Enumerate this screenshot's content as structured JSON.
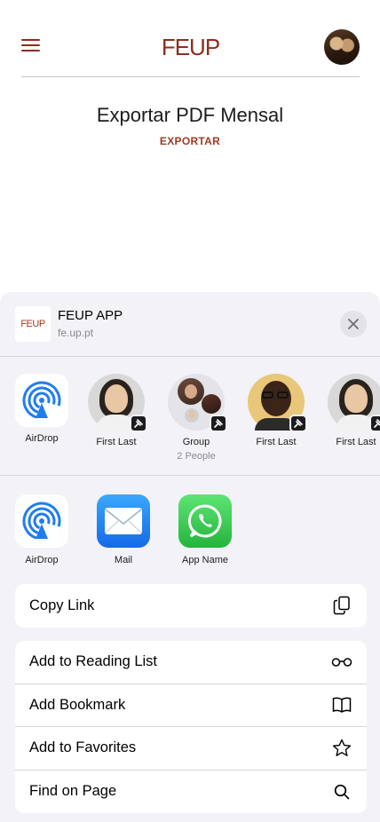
{
  "header": {
    "logo": "FEUP",
    "menu_icon": "hamburger-menu-icon",
    "avatar_icon": "user-avatar"
  },
  "page": {
    "title": "Exportar PDF Mensal",
    "export_label": "EXPORTAR"
  },
  "share_sheet": {
    "app_thumb_text": "FEUP",
    "app_title": "FEUP APP",
    "app_url": "fe.up.pt",
    "close_icon": "close-icon",
    "people": [
      {
        "name": "AirDrop",
        "sub": ""
      },
      {
        "name": "First Last",
        "sub": ""
      },
      {
        "name": "Group",
        "sub": "2 People"
      },
      {
        "name": "First Last",
        "sub": ""
      },
      {
        "name": "First Last",
        "sub": ""
      }
    ],
    "apps": [
      {
        "name": "AirDrop",
        "icon": "airdrop-icon"
      },
      {
        "name": "Mail",
        "icon": "mail-icon"
      },
      {
        "name": "App Name",
        "icon": "whatsapp-icon"
      }
    ],
    "actions_primary": [
      {
        "label": "Copy Link",
        "icon": "copy-icon"
      }
    ],
    "actions_secondary": [
      {
        "label": "Add to Reading List",
        "icon": "glasses-icon"
      },
      {
        "label": "Add Bookmark",
        "icon": "book-icon"
      },
      {
        "label": "Add to Favorites",
        "icon": "star-icon"
      },
      {
        "label": "Find on Page",
        "icon": "search-icon"
      }
    ]
  },
  "colors": {
    "brand": "#8f2d1d",
    "accent": "#a33a1f",
    "sheet_bg": "#f2f2f7"
  }
}
